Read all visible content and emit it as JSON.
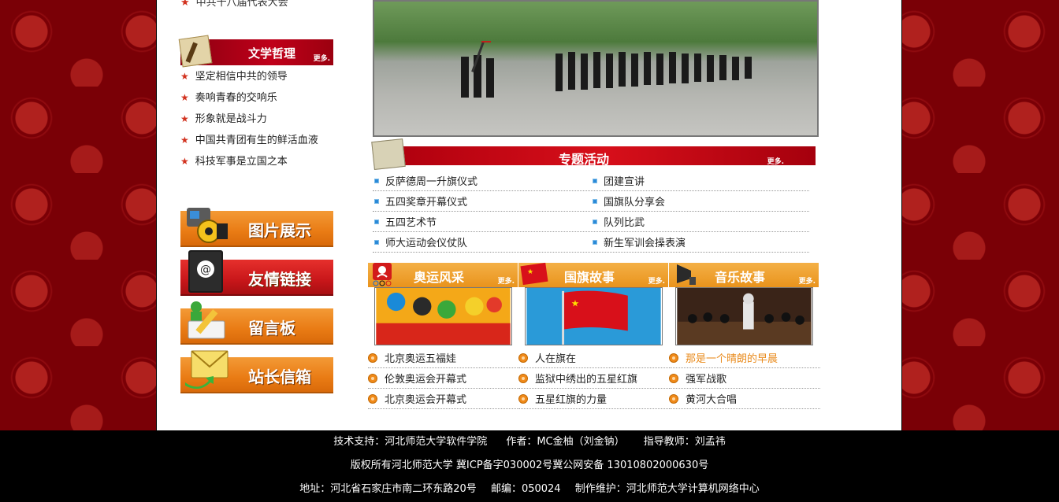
{
  "left": {
    "truncated_item": "中共十八届代表大会",
    "philosophy": {
      "title": "文学哲理",
      "more": "更多.",
      "items": [
        "坚定相信中共的领导",
        "奏响青春的交响乐",
        "形象就是战斗力",
        "中国共青团有生的鲜活血液",
        "科技军事是立国之本"
      ]
    },
    "nav": [
      "图片展示",
      "友情链接",
      "留言板",
      "站长信箱"
    ]
  },
  "topic": {
    "title": "专题活动",
    "more": "更多.",
    "rows": [
      [
        "反萨德周一升旗仪式",
        "团建宣讲"
      ],
      [
        "五四奖章开幕仪式",
        "国旗队分享会"
      ],
      [
        "五四艺术节",
        "队列比武"
      ],
      [
        "师大运动会仪仗队",
        "新生军训会操表演"
      ]
    ]
  },
  "cards": [
    {
      "title": "奥运风采",
      "more": "更多.",
      "items": [
        "北京奥运五福娃",
        "伦敦奥运会开幕式",
        "北京奥运会开幕式"
      ]
    },
    {
      "title": "国旗故事",
      "more": "更多.",
      "items": [
        "人在旗在",
        "监狱中绣出的五星红旗",
        "五星红旗的力量"
      ]
    },
    {
      "title": "音乐故事",
      "more": "更多.",
      "items": [
        "那是一个晴朗的早晨",
        "强军战歌",
        "黄河大合唱"
      ]
    }
  ],
  "footer": {
    "line1": [
      "技术支持：河北师范大学软件学院",
      "作者：MC金柚（刘金钠）",
      "指导教师：刘孟祎"
    ],
    "line2": "版权所有河北师范大学  冀ICP备字030002号冀公网安备  13010802000630号",
    "line3": [
      "地址：河北省石家庄市南二环东路20号",
      "邮编：050024",
      "制作维护：河北师范大学计算机网络中心"
    ]
  },
  "colors": {
    "accent_red": "#c8161a",
    "accent_orange": "#e9931c",
    "link_highlight": "#e98a1b",
    "bg_dark_red": "#7a0006"
  }
}
